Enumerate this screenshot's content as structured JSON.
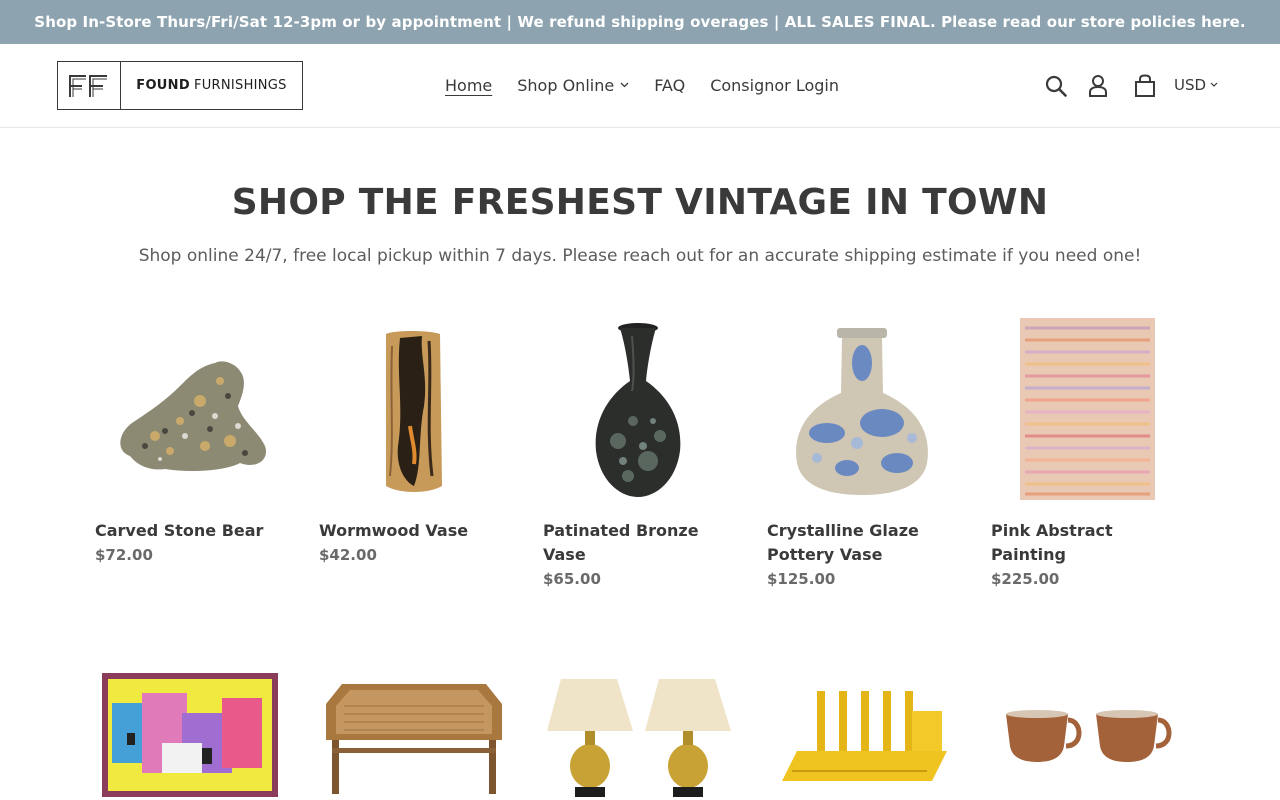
{
  "announcement": "Shop In-Store Thurs/Fri/Sat 12-3pm or by appointment | We refund shipping overages | ALL SALES FINAL. Please read our store policies here.",
  "header": {
    "logo_mark": "FF",
    "logo_bold": "FOUND",
    "logo_rest": "FURNISHINGS",
    "nav": [
      {
        "label": "Home"
      },
      {
        "label": "Shop Online"
      },
      {
        "label": "FAQ"
      },
      {
        "label": "Consignor Login"
      }
    ],
    "currency": "USD",
    "icons": [
      "search-icon",
      "account-icon",
      "cart-icon"
    ]
  },
  "hero": {
    "title": "SHOP THE FRESHEST VINTAGE IN TOWN",
    "subtitle": "Shop online 24/7, free local pickup within 7 days. Please reach out for an accurate shipping estimate if you need one!"
  },
  "products": [
    {
      "title": "Carved Stone Bear",
      "price": "$72.00"
    },
    {
      "title": "Wormwood Vase",
      "price": "$42.00"
    },
    {
      "title": "Patinated Bronze Vase",
      "price": "$65.00"
    },
    {
      "title": "Crystalline Glaze Pottery Vase",
      "price": "$125.00"
    },
    {
      "title": "Pink Abstract Painting",
      "price": "$225.00"
    }
  ],
  "colors": {
    "announcement_bg": "#8ea3b0",
    "text": "#3a3a3a",
    "price": "#6a6a6a"
  }
}
